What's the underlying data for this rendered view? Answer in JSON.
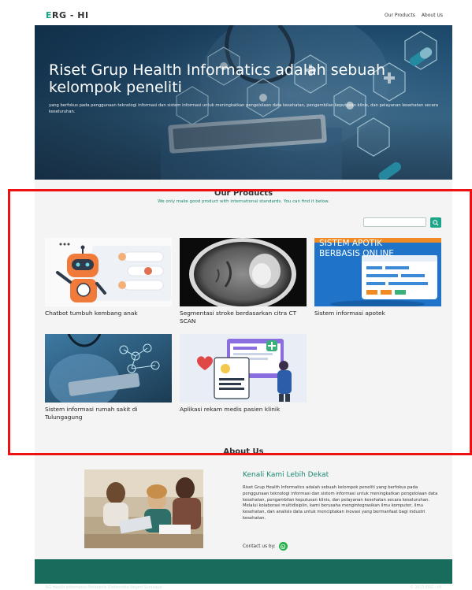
{
  "header": {
    "logo_prefix": "E",
    "logo_rest": "RG - HI",
    "nav": [
      "Our Products",
      "About Us"
    ]
  },
  "hero": {
    "title": "Riset Grup Health Informatics adalah sebuah kelompok peneliti",
    "subtitle": "yang berfokus pada penggunaan teknologi informasi dan sistem informasi untuk meningkatkan pengelolaan data kesehatan, pengambilan keputusan klinis, dan pelayanan kesehatan secara keseluruhan."
  },
  "products": {
    "title": "Our Products",
    "subtitle": "We only make good product with international standards. You can find it below.",
    "search_placeholder": "",
    "items": [
      {
        "title": "Chatbot tumbuh kembang anak"
      },
      {
        "title": "Segmentasi stroke berdasarkan citra CT SCAN"
      },
      {
        "title": "Sistem informasi apotek",
        "image_text": "SISTEM APOTIK BERBASIS ONLINE"
      },
      {
        "title": "Sistem informasi rumah sakit di Tulungagung"
      },
      {
        "title": "Aplikasi rekam medis pasien klinik"
      }
    ]
  },
  "about": {
    "title": "About Us",
    "heading": "Kenali Kami Lebih Dekat",
    "body": "Riset Grup Health Informatics adalah sebuah kelompok peneliti yang berfokus pada penggunaan teknologi informasi dan sistem informasi untuk meningkatkan pengelolaan data kesehatan, pengambilan keputusan klinis, dan pelayanan kesehatan secara keseluruhan. Melalui kolaborasi multidisiplin, kami berusaha mengintegrasikan ilmu komputer, ilmu kesehatan, dan analisis data untuk menciptakan inovasi yang bermanfaat bagi industri kesehatan.",
    "contact_label": "Contact us by:"
  },
  "footer": {
    "left": "RG Health Informatics Politeknik Elektronika Negeri Surabaya",
    "right": "© 2023 ERG - HI"
  },
  "colors": {
    "accent": "#1aa589",
    "footer": "#176c5b",
    "annotation": "#ee1111"
  },
  "icons": [
    "search-icon",
    "whatsapp-icon"
  ]
}
